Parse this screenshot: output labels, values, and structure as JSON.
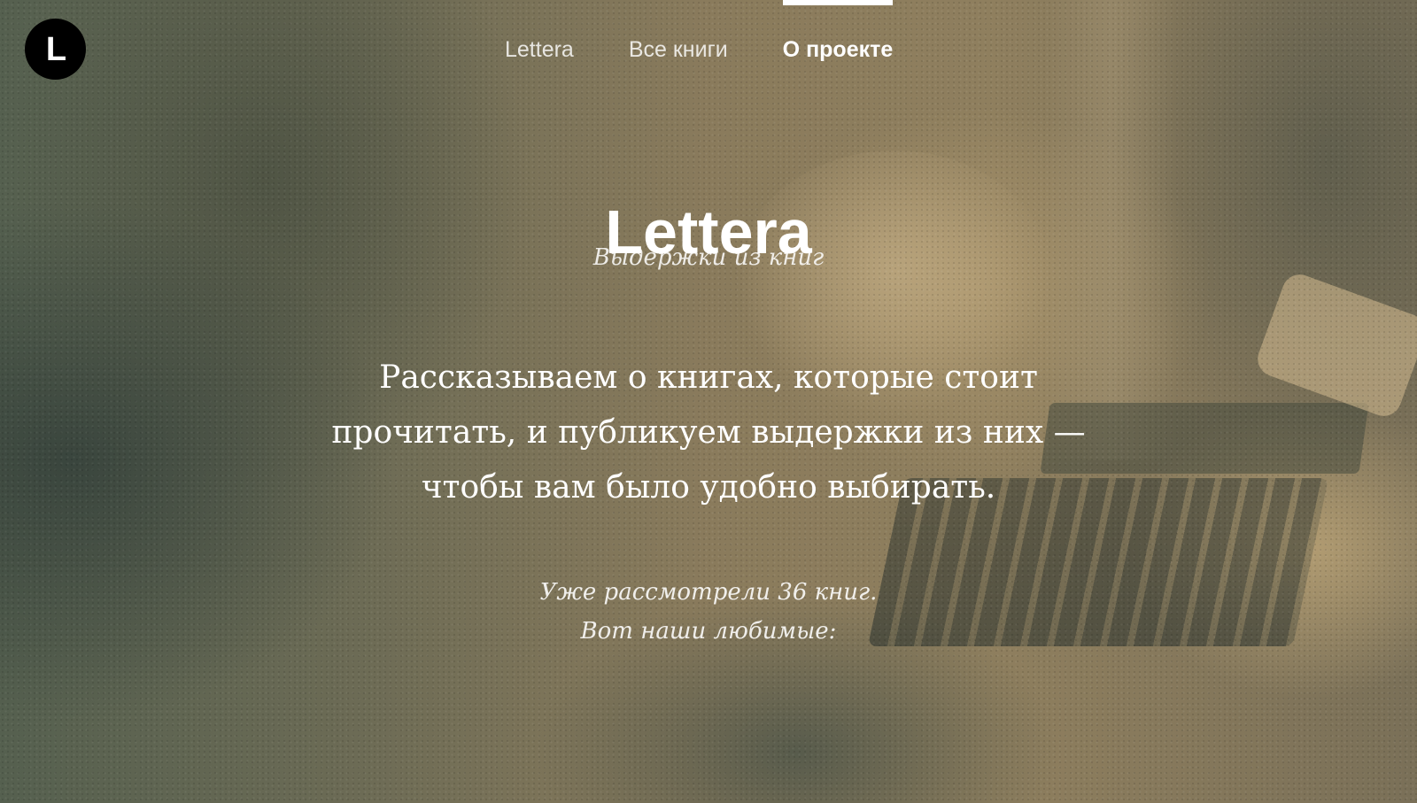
{
  "logo": {
    "letter": "L"
  },
  "nav": {
    "items": [
      {
        "label": "Lettera",
        "active": false
      },
      {
        "label": "Все книги",
        "active": false
      },
      {
        "label": "О проекте",
        "active": true
      }
    ]
  },
  "hero": {
    "title": "Lettera",
    "tagline": "Выдержки из книг",
    "lead": "Рассказываем о книгах, которые стоит прочитать, и публикуем выдержки из них — чтобы вам было удобно выбирать.",
    "stats_line1": "Уже рассмотрели 36 книг.",
    "stats_line2": "Вот наши любимые:"
  },
  "colors": {
    "text": "#ffffff",
    "logo_bg": "#000000",
    "background_tint": "#8a7b5c"
  }
}
